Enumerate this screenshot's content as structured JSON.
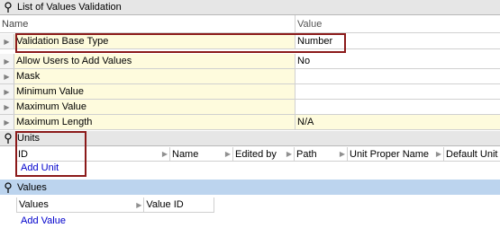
{
  "sections": {
    "list_of_values": {
      "title": "List of Values Validation"
    },
    "units": {
      "title": "Units"
    },
    "values": {
      "title": "Values"
    }
  },
  "lov_grid": {
    "columns": {
      "name": "Name",
      "value": "Value"
    },
    "rows": [
      {
        "name": "Validation Base Type",
        "value": "Number"
      },
      {
        "name": "Allow Users to Add Values",
        "value": "No"
      },
      {
        "name": "Mask",
        "value": ""
      },
      {
        "name": "Minimum Value",
        "value": ""
      },
      {
        "name": "Maximum Value",
        "value": ""
      },
      {
        "name": "Maximum Length",
        "value": "N/A"
      }
    ]
  },
  "units_grid": {
    "columns": [
      "ID",
      "Name",
      "Edited by",
      "Path",
      "Unit Proper Name",
      "Default Unit"
    ],
    "add_link": "Add Unit"
  },
  "values_grid": {
    "columns": [
      "Values",
      "Value ID"
    ],
    "add_link": "Add Value"
  },
  "icons": {
    "pin": "pin-icon",
    "row_arrow": "chevron-right-icon"
  },
  "colors": {
    "highlight_box": "#8b1a1a",
    "name_cell_bg": "#fefbdd",
    "values_header_bg": "#bcd4ee",
    "link": "#0000cc"
  }
}
